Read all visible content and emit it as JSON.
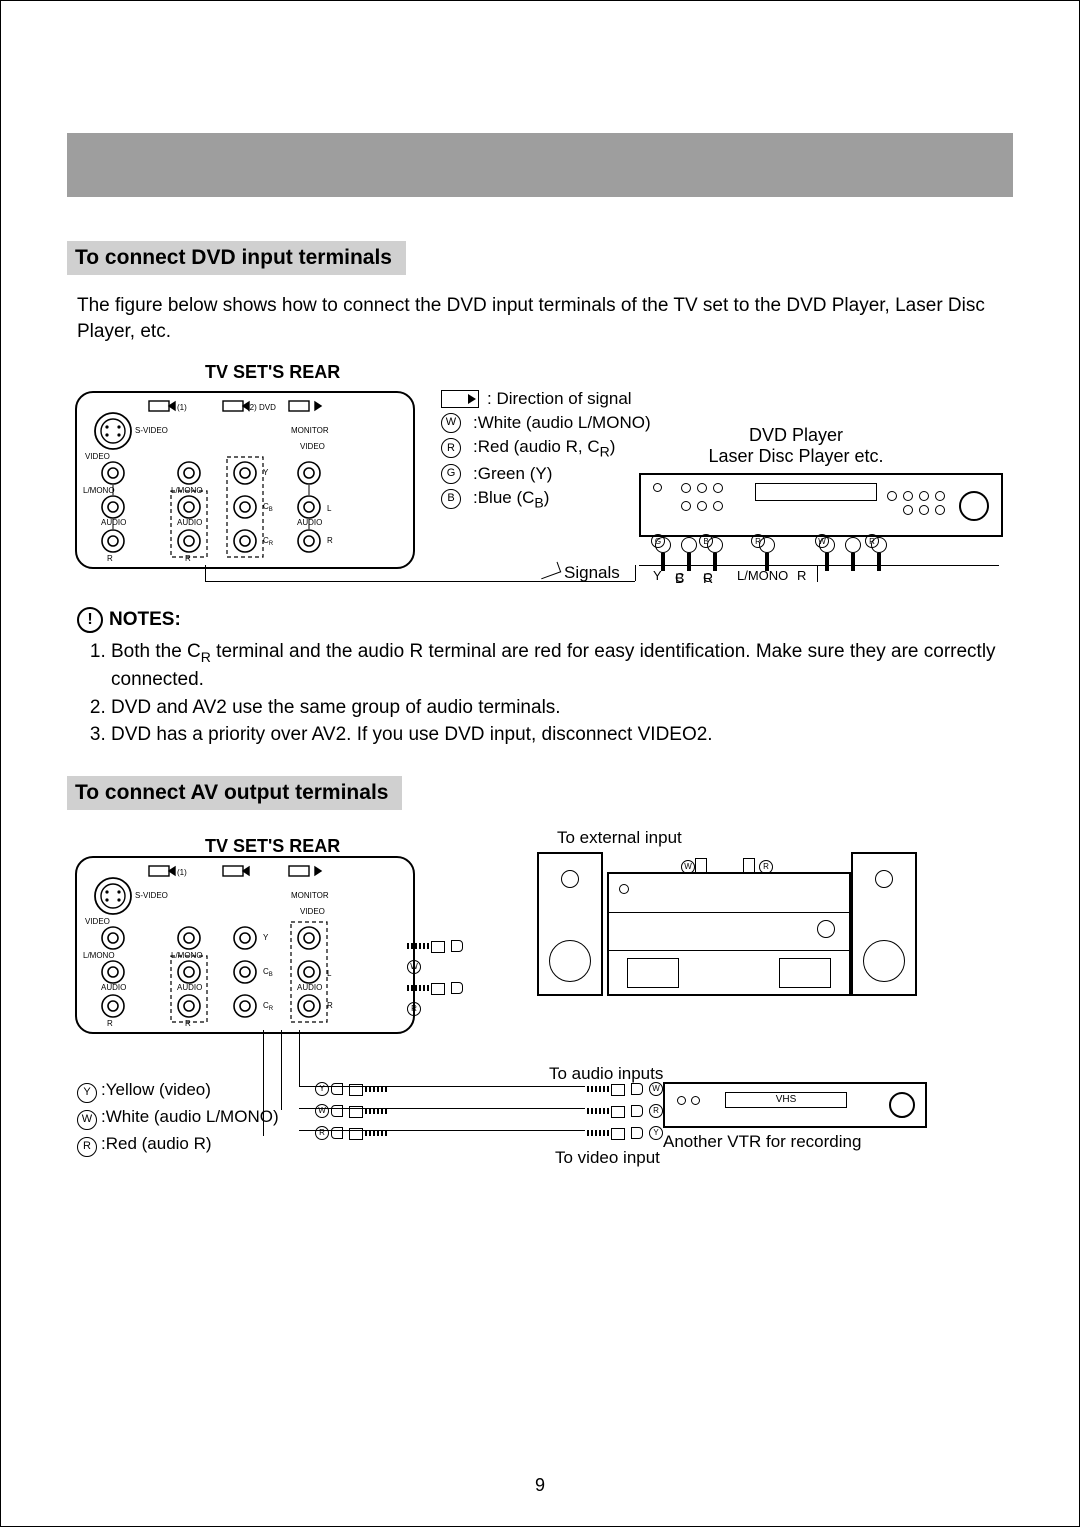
{
  "section1": {
    "title": "To connect DVD input terminals",
    "intro": "The figure below shows how to connect the DVD input terminals of the TV set to the DVD Player, Laser Disc Player, etc.",
    "panel_label": "TV SET'S REAR",
    "signal_direction": ": Direction of signal",
    "legend": {
      "w": ":White (audio L/MONO)",
      "r_pre": ":Red (audio R, C",
      "r_sub": "R",
      "r_post": ")",
      "g": ":Green (Y)",
      "b_pre": ":Blue (C",
      "b_sub": "B",
      "b_post": ")"
    },
    "player_label1": "DVD Player",
    "player_label2": "Laser Disc Player etc.",
    "signals": "Signals",
    "conn_labels": {
      "y": "Y",
      "cb_pre": "C",
      "cb_sub": "B",
      "cr_pre": "C",
      "cr_sub": "R",
      "lmono": "L/MONO",
      "r": "R"
    },
    "rear_labels": {
      "in1": "(1)",
      "in2dvd": "(2) DVD",
      "svideo": "S-VIDEO",
      "monitor": "MONITOR",
      "video": "VIDEO",
      "video2": "VIDEO",
      "lmono": "L/MONO",
      "lmono2": "L/MONO",
      "audio": "AUDIO",
      "r": "R",
      "y": "Y",
      "cb_pre": "C",
      "cb_sub": "B",
      "cr_pre": "C",
      "cr_sub": "R",
      "l": "L"
    }
  },
  "notes": {
    "title": "NOTES:",
    "icon": "!",
    "items": [
      {
        "pre": "Both the C",
        "sub": "R",
        "post": " terminal and the audio R terminal are red for easy identification. Make sure they are correctly connected."
      },
      {
        "pre": "DVD and AV2 use the same group of audio terminals.",
        "sub": "",
        "post": ""
      },
      {
        "pre": "DVD has a priority over AV2. If you use DVD input, disconnect VIDEO2.",
        "sub": "",
        "post": ""
      }
    ]
  },
  "section2": {
    "title": "To connect AV output terminals",
    "panel_label": "TV SET'S REAR",
    "to_external": "To external input",
    "to_audio": "To audio inputs",
    "to_video": "To video input",
    "vtr_label": "Another VTR for recording",
    "vhs": "VHS",
    "legend": {
      "y": ":Yellow (video)",
      "w": ":White (audio L/MONO)",
      "r": ":Red (audio R)"
    }
  },
  "page_num": "9",
  "circle_letters": {
    "w": "W",
    "r": "R",
    "g": "G",
    "b": "B",
    "y": "Y"
  }
}
